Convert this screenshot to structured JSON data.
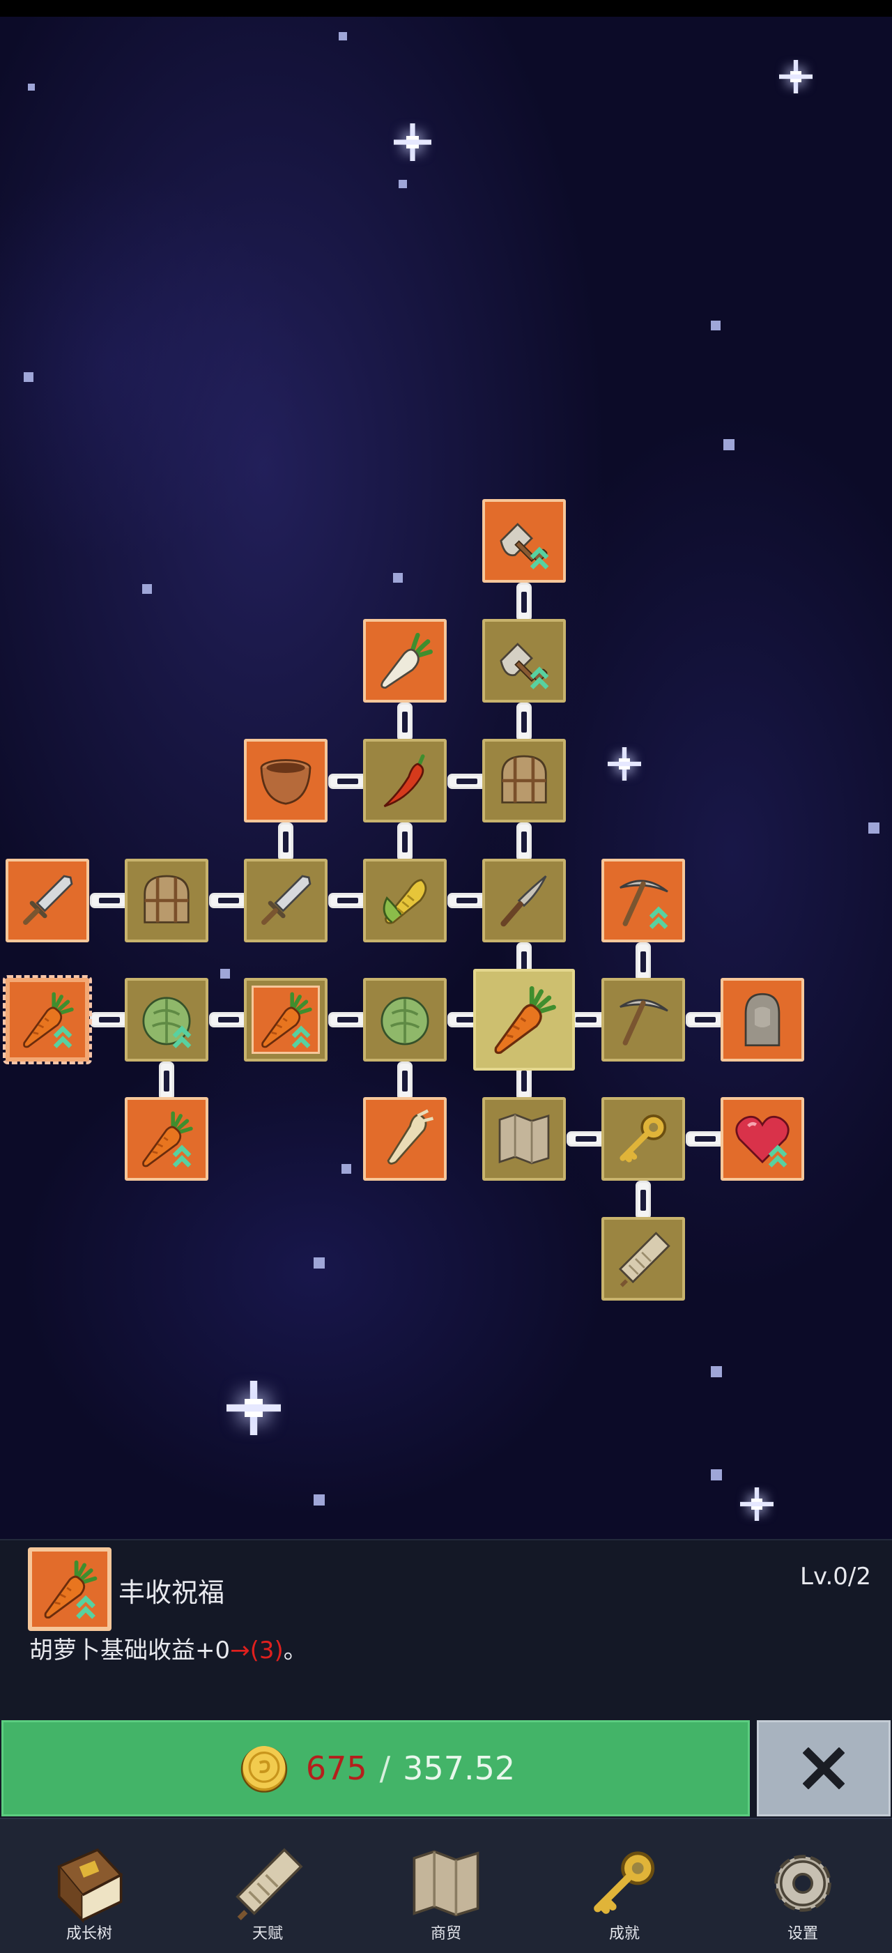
{
  "skill_tree": {
    "nodes": [
      {
        "id": "shovel-upgrade-top",
        "icon": "shovel-up-icon"
      },
      {
        "id": "radish",
        "icon": "radish-icon"
      },
      {
        "id": "shovel-upgrade",
        "icon": "shovel-up-icon"
      },
      {
        "id": "clay-pot",
        "icon": "pot-icon"
      },
      {
        "id": "chili",
        "icon": "chili-icon"
      },
      {
        "id": "backpack-top",
        "icon": "backpack-icon"
      },
      {
        "id": "sword-left",
        "icon": "sword-icon"
      },
      {
        "id": "backpack-left",
        "icon": "backpack-icon"
      },
      {
        "id": "sword-center",
        "icon": "sword-icon"
      },
      {
        "id": "corn",
        "icon": "corn-icon"
      },
      {
        "id": "knife",
        "icon": "knife-icon"
      },
      {
        "id": "pickaxe-upgrade",
        "icon": "pickaxe-up-icon"
      },
      {
        "id": "carrot-blessing-highlighted",
        "icon": "carrot-up-icon"
      },
      {
        "id": "cabbage-left",
        "icon": "cabbage-up-icon"
      },
      {
        "id": "carrot-blessing-mid",
        "icon": "carrot-up-icon"
      },
      {
        "id": "cabbage-center",
        "icon": "cabbage-icon"
      },
      {
        "id": "carrot-center",
        "icon": "carrot-icon"
      },
      {
        "id": "pickaxe",
        "icon": "pickaxe-icon"
      },
      {
        "id": "stone-statue",
        "icon": "statue-icon"
      },
      {
        "id": "carrot-double-up",
        "icon": "carrot-double-up-icon"
      },
      {
        "id": "parsnip",
        "icon": "parsnip-icon"
      },
      {
        "id": "map",
        "icon": "map-icon"
      },
      {
        "id": "golden-key",
        "icon": "key-icon"
      },
      {
        "id": "heart-upgrade",
        "icon": "heart-up-icon"
      },
      {
        "id": "scroll",
        "icon": "scroll-icon"
      }
    ]
  },
  "detail": {
    "icon": "carrot-up-icon",
    "title": "丰收祝福",
    "level": "Lv.0/2",
    "desc_prefix": "胡萝卜基础收益+0",
    "desc_arrow": "→(3)",
    "desc_suffix": "。"
  },
  "purchase": {
    "coin_icon": "gold-coin-icon",
    "current": "675",
    "separator": "/",
    "cost": "357.52",
    "close_icon": "close-icon"
  },
  "nav": [
    {
      "label": "成长树",
      "icon": "book-icon"
    },
    {
      "label": "天赋",
      "icon": "scroll-icon"
    },
    {
      "label": "商贸",
      "icon": "map-icon"
    },
    {
      "label": "成就",
      "icon": "key-icon"
    },
    {
      "label": "设置",
      "icon": "gear-icon"
    }
  ],
  "colors": {
    "node_locked": "#e26c2b",
    "node_unlocked": "#9b8541",
    "buy_button": "#43b468",
    "price_insufficient": "#b41f1c"
  }
}
